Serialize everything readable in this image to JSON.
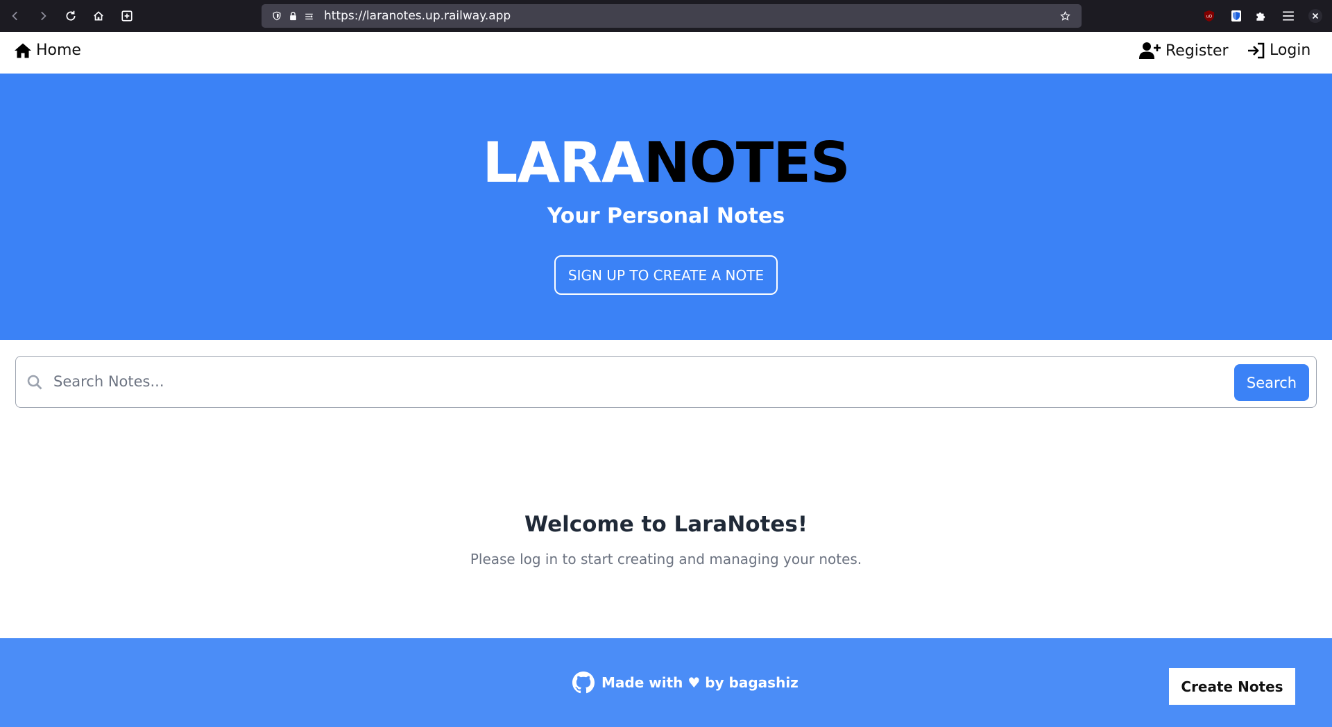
{
  "browser": {
    "url": "https://laranotes.up.railway.app"
  },
  "navbar": {
    "home_label": "Home",
    "register_label": "Register",
    "login_label": "Login"
  },
  "hero": {
    "title_part1": "LARA",
    "title_part2": "NOTES",
    "subtitle": "Your Personal Notes",
    "cta_label": "SIGN UP TO CREATE A NOTE"
  },
  "search": {
    "placeholder": "Search Notes...",
    "value": "",
    "button_label": "Search"
  },
  "welcome": {
    "title": "Welcome to LaraNotes!",
    "message": "Please log in to start creating and managing your notes."
  },
  "footer": {
    "credit": "Made with ♥ by bagashiz",
    "create_label": "Create Notes"
  },
  "colors": {
    "hero_bg": "#3b82f6",
    "footer_bg": "#4b8df7",
    "accent": "#3b82f6"
  }
}
